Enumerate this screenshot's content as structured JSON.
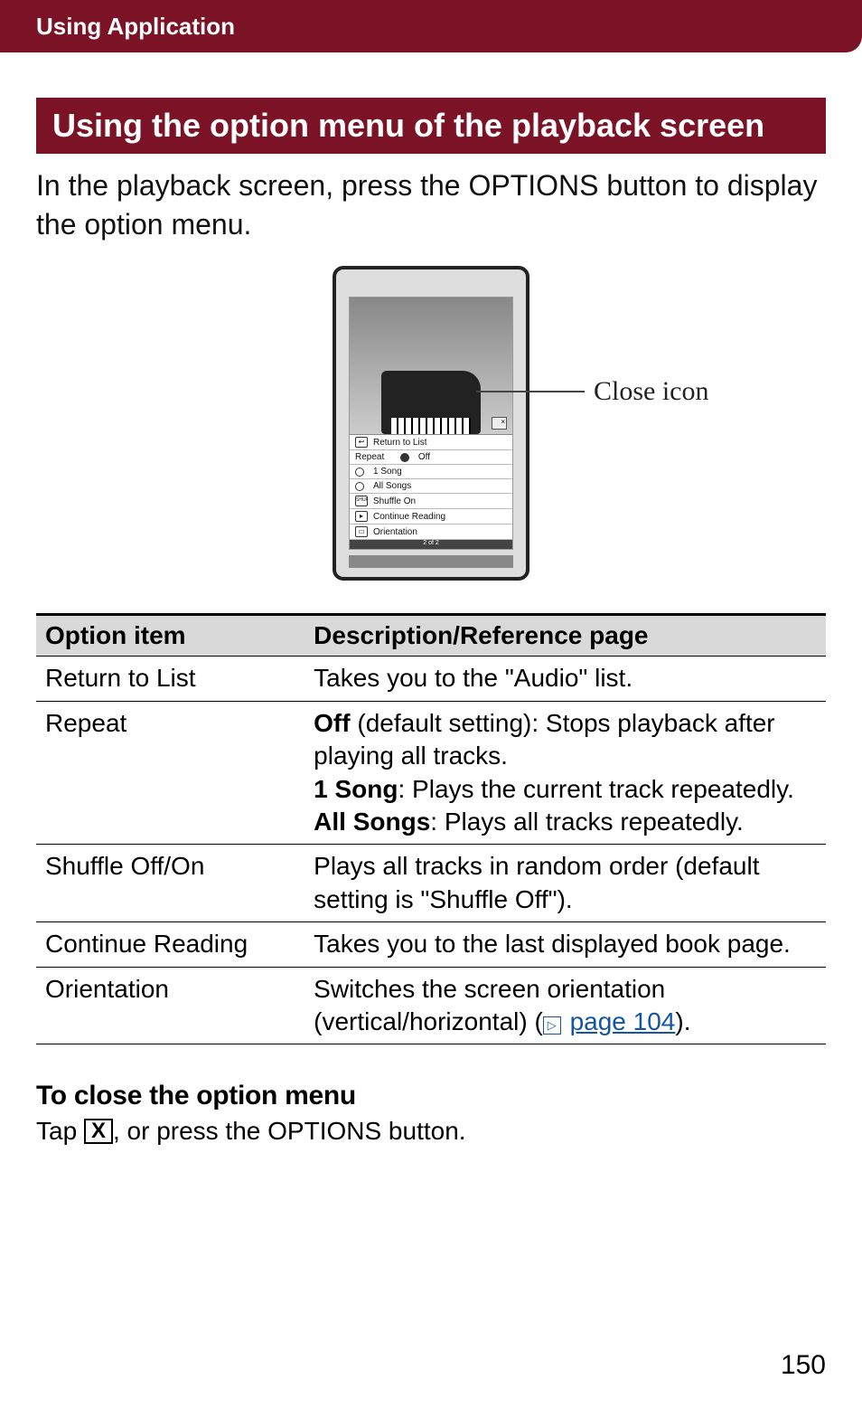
{
  "header": {
    "breadcrumb": "Using Application"
  },
  "section_title": "Using the option menu of the playback screen",
  "intro": "In the playback screen, press the OPTIONS button to display the option menu.",
  "callout": "Close icon",
  "device_menu": {
    "return": "Return to List",
    "repeat_label": "Repeat",
    "repeat_off": "Off",
    "repeat_1song": "1 Song",
    "repeat_all": "All Songs",
    "shuffle": "Shuffle On",
    "continue": "Continue Reading",
    "orientation": "Orientation",
    "pager": "2 of 2",
    "shuf_badge": "SHUF"
  },
  "table": {
    "head_option": "Option item",
    "head_desc": "Description/Reference page",
    "rows": {
      "return": {
        "name": "Return to List",
        "desc": "Takes you to the \"Audio\" list."
      },
      "repeat": {
        "name": "Repeat",
        "off_b": "Off",
        "off_rest": " (default setting): Stops playback after playing all tracks.",
        "one_b": "1 Song",
        "one_rest": ": Plays the current track repeatedly.",
        "all_b": "All Songs",
        "all_rest": ": Plays all tracks repeatedly."
      },
      "shuffle": {
        "name": "Shuffle Off/On",
        "desc": "Plays all tracks in random order (default setting is \"Shuffle Off\")."
      },
      "continue": {
        "name": "Continue Reading",
        "desc": "Takes you to the last displayed book page."
      },
      "orientation": {
        "name": "Orientation",
        "desc_pre": "Switches the screen orientation (vertical/horizontal) (",
        "link_text": "page 104",
        "desc_post": ")."
      }
    }
  },
  "close_section": {
    "heading": "To close the option menu",
    "pre": "Tap ",
    "x": "X",
    "post": ", or press the OPTIONS button."
  },
  "page_number": "150"
}
